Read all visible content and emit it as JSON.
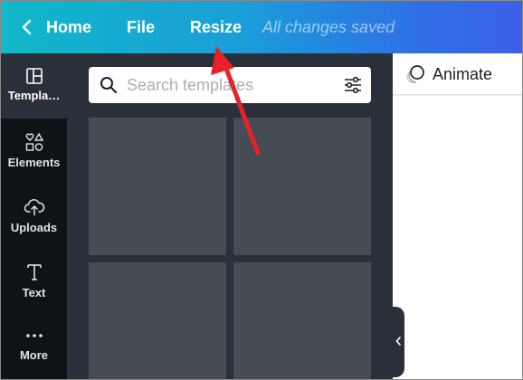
{
  "topbar": {
    "home_label": "Home",
    "file_label": "File",
    "resize_label": "Resize",
    "saved_status": "All changes saved"
  },
  "sidebar": {
    "items": [
      {
        "label": "Templa…",
        "icon": "templates-icon",
        "active": true
      },
      {
        "label": "Elements",
        "icon": "elements-icon"
      },
      {
        "label": "Uploads",
        "icon": "upload-cloud-icon"
      },
      {
        "label": "Text",
        "icon": "text-icon"
      },
      {
        "label": "More",
        "icon": "more-dots-icon"
      }
    ]
  },
  "search": {
    "placeholder": "Search templates"
  },
  "animate": {
    "label": "Animate"
  },
  "colors": {
    "topbar_start": "#10b8c8",
    "topbar_end": "#3d5fe8",
    "rail": "#0e1318",
    "panel": "#293039",
    "thumbnail": "#454c54",
    "annotation_arrow": "#e8202a"
  }
}
